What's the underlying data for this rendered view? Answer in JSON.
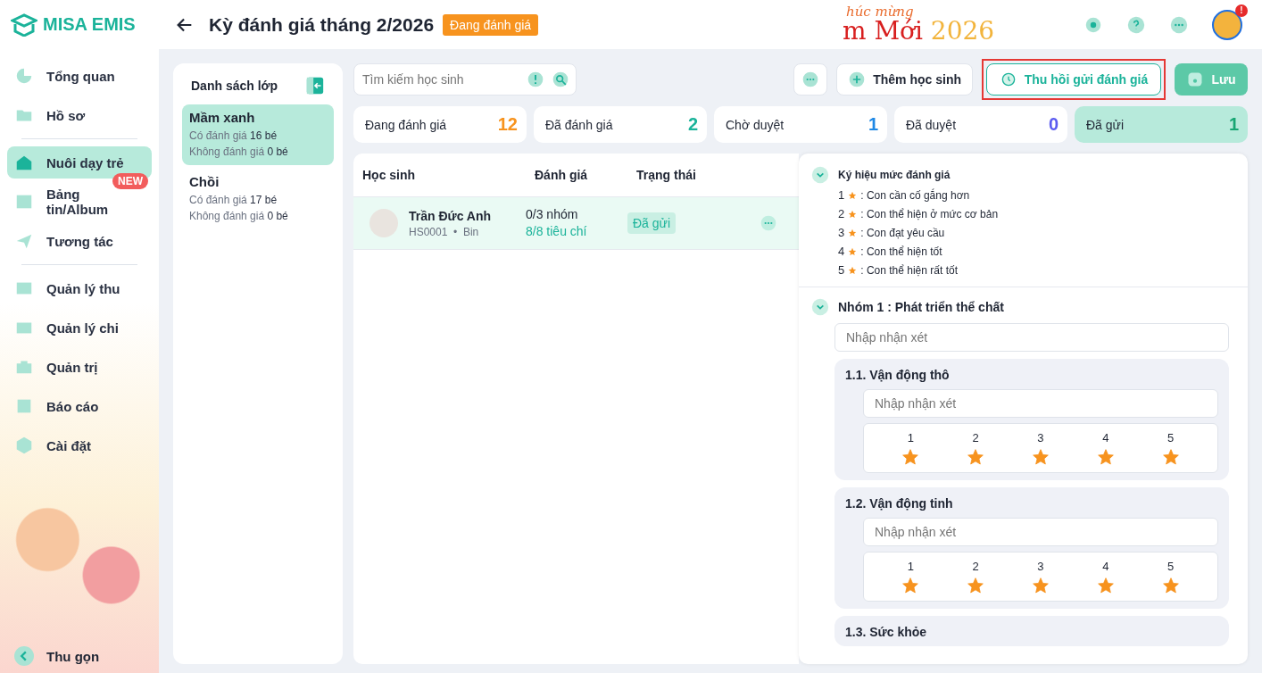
{
  "brand": {
    "name": "MISA EMIS"
  },
  "sidebar": {
    "sections": [
      {
        "items": [
          {
            "label": "Tổng quan",
            "selected": false
          },
          {
            "label": "Hồ sơ",
            "selected": false
          }
        ]
      },
      {
        "items": [
          {
            "label": "Nuôi dạy trẻ",
            "selected": true
          },
          {
            "label": "Bảng tin/Album",
            "selected": false,
            "badge": "NEW"
          },
          {
            "label": "Tương tác",
            "selected": false
          }
        ]
      },
      {
        "items": [
          {
            "label": "Quản lý thu",
            "selected": false
          },
          {
            "label": "Quản lý chi",
            "selected": false
          },
          {
            "label": "Quản trị",
            "selected": false
          },
          {
            "label": "Báo cáo",
            "selected": false
          },
          {
            "label": "Cài đặt",
            "selected": false
          }
        ]
      }
    ],
    "collapse": "Thu gọn"
  },
  "header": {
    "title": "Kỳ đánh giá tháng 2/2026",
    "status": "Đang đánh giá",
    "banner": {
      "line_1": "húc mừng",
      "line_2_red": "m Mới",
      "line_2_year": "2026"
    },
    "notification_badge": "!"
  },
  "class_list": {
    "title": "Danh sách lớp",
    "classes": [
      {
        "name": "Mầm xanh",
        "selected": true,
        "rated_label": "Có đánh giá",
        "rated": "16 bé",
        "unrated_label": "Không đánh giá",
        "unrated": "0 bé"
      },
      {
        "name": "Chồi",
        "selected": false,
        "rated_label": "Có đánh giá",
        "rated": "17 bé",
        "unrated_label": "Không đánh giá",
        "unrated": "0 bé"
      }
    ]
  },
  "search": {
    "placeholder": "Tìm kiếm học sinh"
  },
  "toolbar": [
    {
      "kind": "more"
    },
    {
      "kind": "add",
      "label": "Thêm học sinh"
    },
    {
      "kind": "recall",
      "label": "Thu hồi gửi đánh giá",
      "highlighted": true
    },
    {
      "kind": "save",
      "label": "Lưu"
    }
  ],
  "status_tabs": [
    {
      "label": "Đang đánh giá",
      "count": "12",
      "color": "#f7931e",
      "selected": false
    },
    {
      "label": "Đã đánh giá",
      "count": "2",
      "color": "#1bb39a",
      "selected": false
    },
    {
      "label": "Chờ duyệt",
      "count": "1",
      "color": "#1e88e5",
      "selected": false
    },
    {
      "label": "Đã duyệt",
      "count": "0",
      "color": "#5b5bf0",
      "selected": false
    },
    {
      "label": "Đã gửi",
      "count": "1",
      "color": "#17a673",
      "selected": true
    }
  ],
  "table": {
    "columns": [
      "Học sinh",
      "Đánh giá",
      "Trạng thái"
    ],
    "rows": [
      {
        "name": "Trần Đức Anh",
        "code": "HS0001",
        "separator": "•",
        "nickname": "Bin",
        "groups": "0/3 nhóm",
        "criteria": "8/8 tiêu chí",
        "status": "Đã gửi",
        "selected": true
      }
    ]
  },
  "evaluation": {
    "legend": {
      "title": "Ký hiệu mức đánh giá",
      "expanded": true,
      "levels": [
        {
          "number": "1",
          "text": ": Con cần cố gắng hơn"
        },
        {
          "number": "2",
          "text": ": Con thể hiện ở mức cơ bản"
        },
        {
          "number": "3",
          "text": ": Con đạt yêu cầu"
        },
        {
          "number": "4",
          "text": ": Con thể hiện tốt"
        },
        {
          "number": "5",
          "text": ": Con thể hiện rất tốt"
        }
      ]
    },
    "groups": [
      {
        "title": "Nhóm 1 : Phát triển thể chất",
        "expanded": true,
        "comment_placeholder": "Nhập nhận xét",
        "criteria": [
          {
            "title": "1.1. Vận động thô",
            "comment_placeholder": "Nhập nhận xét",
            "options": [
              "1",
              "2",
              "3",
              "4",
              "5"
            ]
          },
          {
            "title": "1.2. Vận động tinh",
            "comment_placeholder": "Nhập nhận xét",
            "options": [
              "1",
              "2",
              "3",
              "4",
              "5"
            ]
          },
          {
            "title": "1.3. Sức khỏe"
          }
        ]
      }
    ]
  }
}
